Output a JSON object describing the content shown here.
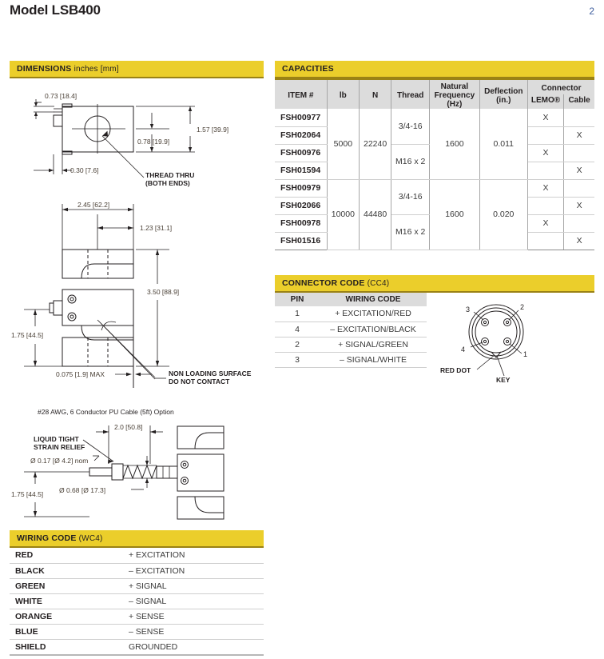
{
  "header": {
    "title": "Model LSB400",
    "page_number": "2"
  },
  "dimensions_panel": {
    "band_title": "DIMENSIONS",
    "band_subtitle": "inches [mm]",
    "top_view": {
      "d_073": "0.73 [18.4]",
      "d_157": "1.57 [39.9]",
      "d_078": "0.78 [19.9]",
      "d_030": "0.30 [7.6]",
      "note_line1": "THREAD THRU",
      "note_line2": "(BOTH ENDS)"
    },
    "front_view": {
      "d_245": "2.45 [62.2]",
      "d_123": "1.23 [31.1]",
      "d_350": "3.50 [88.9]",
      "d_175": "1.75 [44.5]",
      "d_0075": "0.075 [1.9] MAX",
      "note_line1": "NON LOADING SURFACE",
      "note_line2": "DO NOT CONTACT"
    },
    "cable_view": {
      "title": "#28 AWG, 6 Conductor PU Cable (5ft) Option",
      "strain_relief_line1": "LIQUID TIGHT",
      "strain_relief_line2": "STRAIN RELIEF",
      "d_017": "Ø 0.17 [Ø 4.2] nom",
      "d_20": "2.0 [50.8]",
      "d_068": "Ø 0.68 [Ø 17.3]",
      "d_175": "1.75 [44.5]"
    }
  },
  "capacities": {
    "band_title": "CAPACITIES",
    "columns": {
      "item": "ITEM #",
      "lb": "lb",
      "n": "N",
      "thread": "Thread",
      "natural_frequency_l1": "Natural",
      "natural_frequency_l2": "Frequency",
      "natural_frequency_l3": "(Hz)",
      "deflection_l1": "Deflection",
      "deflection_l2": "(in.)",
      "connector": "Connector",
      "lemo": "LEMO®",
      "cable": "Cable"
    },
    "rows": [
      {
        "item": "FSH00977",
        "lemo": "X",
        "cable": ""
      },
      {
        "item": "FSH02064",
        "lemo": "",
        "cable": "X"
      },
      {
        "item": "FSH00976",
        "lemo": "X",
        "cable": ""
      },
      {
        "item": "FSH01594",
        "lemo": "",
        "cable": "X"
      },
      {
        "item": "FSH00979",
        "lemo": "X",
        "cable": ""
      },
      {
        "item": "FSH02066",
        "lemo": "",
        "cable": "X"
      },
      {
        "item": "FSH00978",
        "lemo": "X",
        "cable": ""
      },
      {
        "item": "FSH01516",
        "lemo": "",
        "cable": "X"
      }
    ],
    "groups": [
      {
        "lb": "5000",
        "n": "22240",
        "threads": [
          "3/4-16",
          "M16 x 2"
        ],
        "natural_frequency": "1600",
        "deflection": "0.011"
      },
      {
        "lb": "10000",
        "n": "44480",
        "threads": [
          "3/4-16",
          "M16 x 2"
        ],
        "natural_frequency": "1600",
        "deflection": "0.020"
      }
    ]
  },
  "connector_code": {
    "band_title": "CONNECTOR CODE",
    "band_code": "(CC4)",
    "columns": {
      "pin": "PIN",
      "wiring_code": "WIRING CODE"
    },
    "rows": [
      {
        "pin": "1",
        "wiring_code": "+ EXCITATION/RED"
      },
      {
        "pin": "4",
        "wiring_code": "– EXCITATION/BLACK"
      },
      {
        "pin": "2",
        "wiring_code": "+ SIGNAL/GREEN"
      },
      {
        "pin": "3",
        "wiring_code": "– SIGNAL/WHITE"
      }
    ],
    "diagram": {
      "pin_labels": [
        "1",
        "2",
        "3",
        "4"
      ],
      "red_dot_label": "RED DOT",
      "key_label": "KEY"
    }
  },
  "wiring_code": {
    "band_title": "WIRING CODE",
    "band_code": "(WC4)",
    "rows": [
      {
        "color": "RED",
        "function": "+ EXCITATION"
      },
      {
        "color": "BLACK",
        "function": "– EXCITATION"
      },
      {
        "color": "GREEN",
        "function": "+ SIGNAL"
      },
      {
        "color": "WHITE",
        "function": "– SIGNAL"
      },
      {
        "color": "ORANGE",
        "function": "+ SENSE"
      },
      {
        "color": "BLUE",
        "function": "– SENSE"
      },
      {
        "color": "SHIELD",
        "function": "GROUNDED"
      }
    ]
  },
  "colors": {
    "band_yellow": "#EBCE2B",
    "band_underline": "#9A8215",
    "table_header_gray": "#DCDCDC",
    "dim_text": "#4A4036",
    "page_number": "#3F5E9E"
  }
}
